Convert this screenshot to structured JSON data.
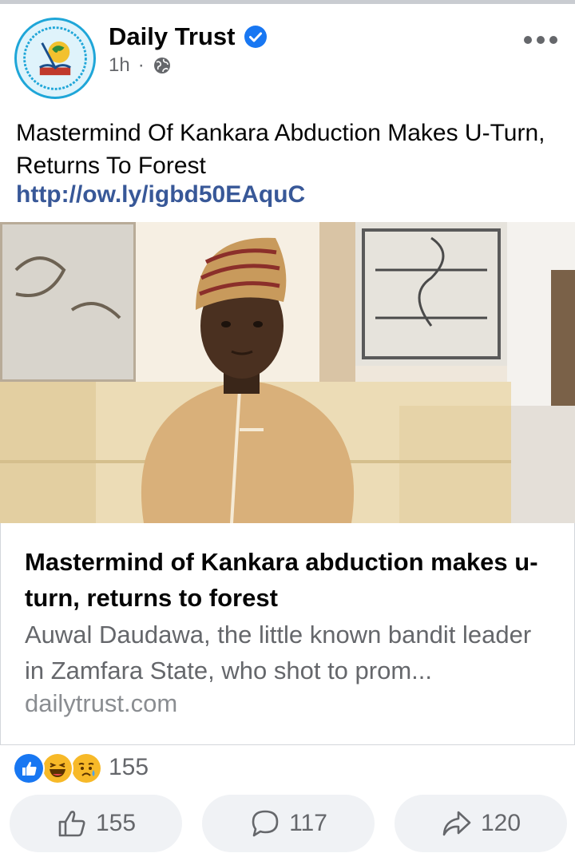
{
  "post": {
    "page_name": "Daily Trust",
    "verified_icon": "verified-badge-icon",
    "time": "1h",
    "separator": "·",
    "audience_icon": "globe-icon",
    "text": "Mastermind Of Kankara Abduction Makes U-Turn, Returns To Forest",
    "link": "http://ow.ly/igbd50EAquC"
  },
  "link_preview": {
    "title": "Mastermind of Kankara abduction makes u-turn, returns to forest",
    "description": "Auwal Daudawa, the little known bandit leader in Zamfara State, who shot to prom...",
    "domain": "dailytrust.com"
  },
  "reactions": {
    "icons": [
      "like-icon",
      "haha-icon",
      "sad-icon"
    ],
    "count": "155"
  },
  "actions": {
    "like": "155",
    "comment": "117",
    "share": "120"
  },
  "colors": {
    "link": "#385898",
    "facebook_blue": "#1877f2",
    "muted": "#65676b",
    "button_bg": "#f0f2f5"
  }
}
